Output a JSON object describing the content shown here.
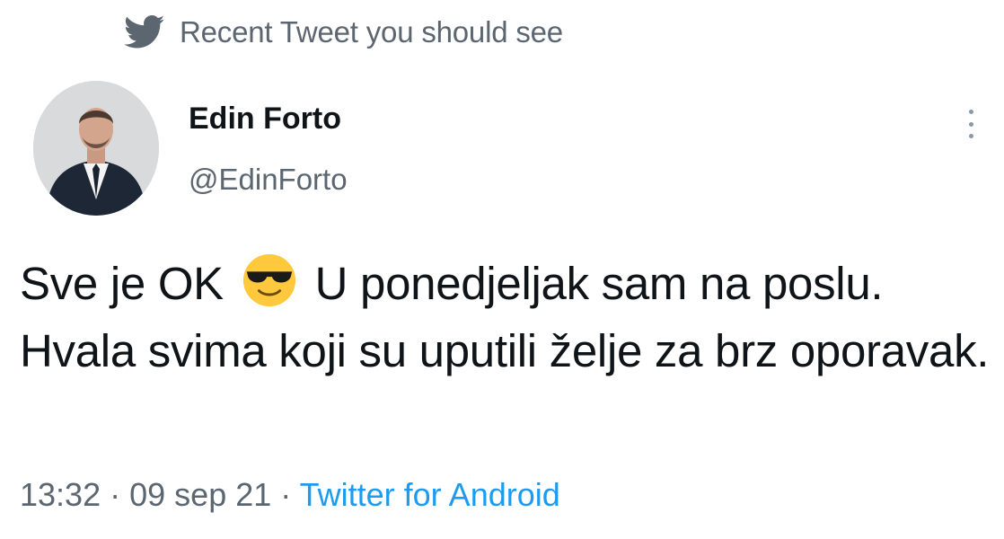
{
  "context_bar": {
    "icon": "twitter-bird-icon",
    "text": "Recent Tweet you should see"
  },
  "author": {
    "avatar": "avatar",
    "name": "Edin Forto",
    "handle": "@EdinForto"
  },
  "tweet": {
    "text_part1": "Sve je OK",
    "emoji": "smiling-face-with-sunglasses-icon",
    "text_part2": "U ponedjeljak sam na poslu. Hvala svima koji su uputili želje za brz oporavak."
  },
  "meta": {
    "time": "13:32",
    "separator": "·",
    "date": "09 sep 21",
    "source": "Twitter for Android"
  },
  "colors": {
    "accent": "#1d9bf0",
    "text_primary": "#0f1419",
    "text_secondary": "#5b6670"
  }
}
